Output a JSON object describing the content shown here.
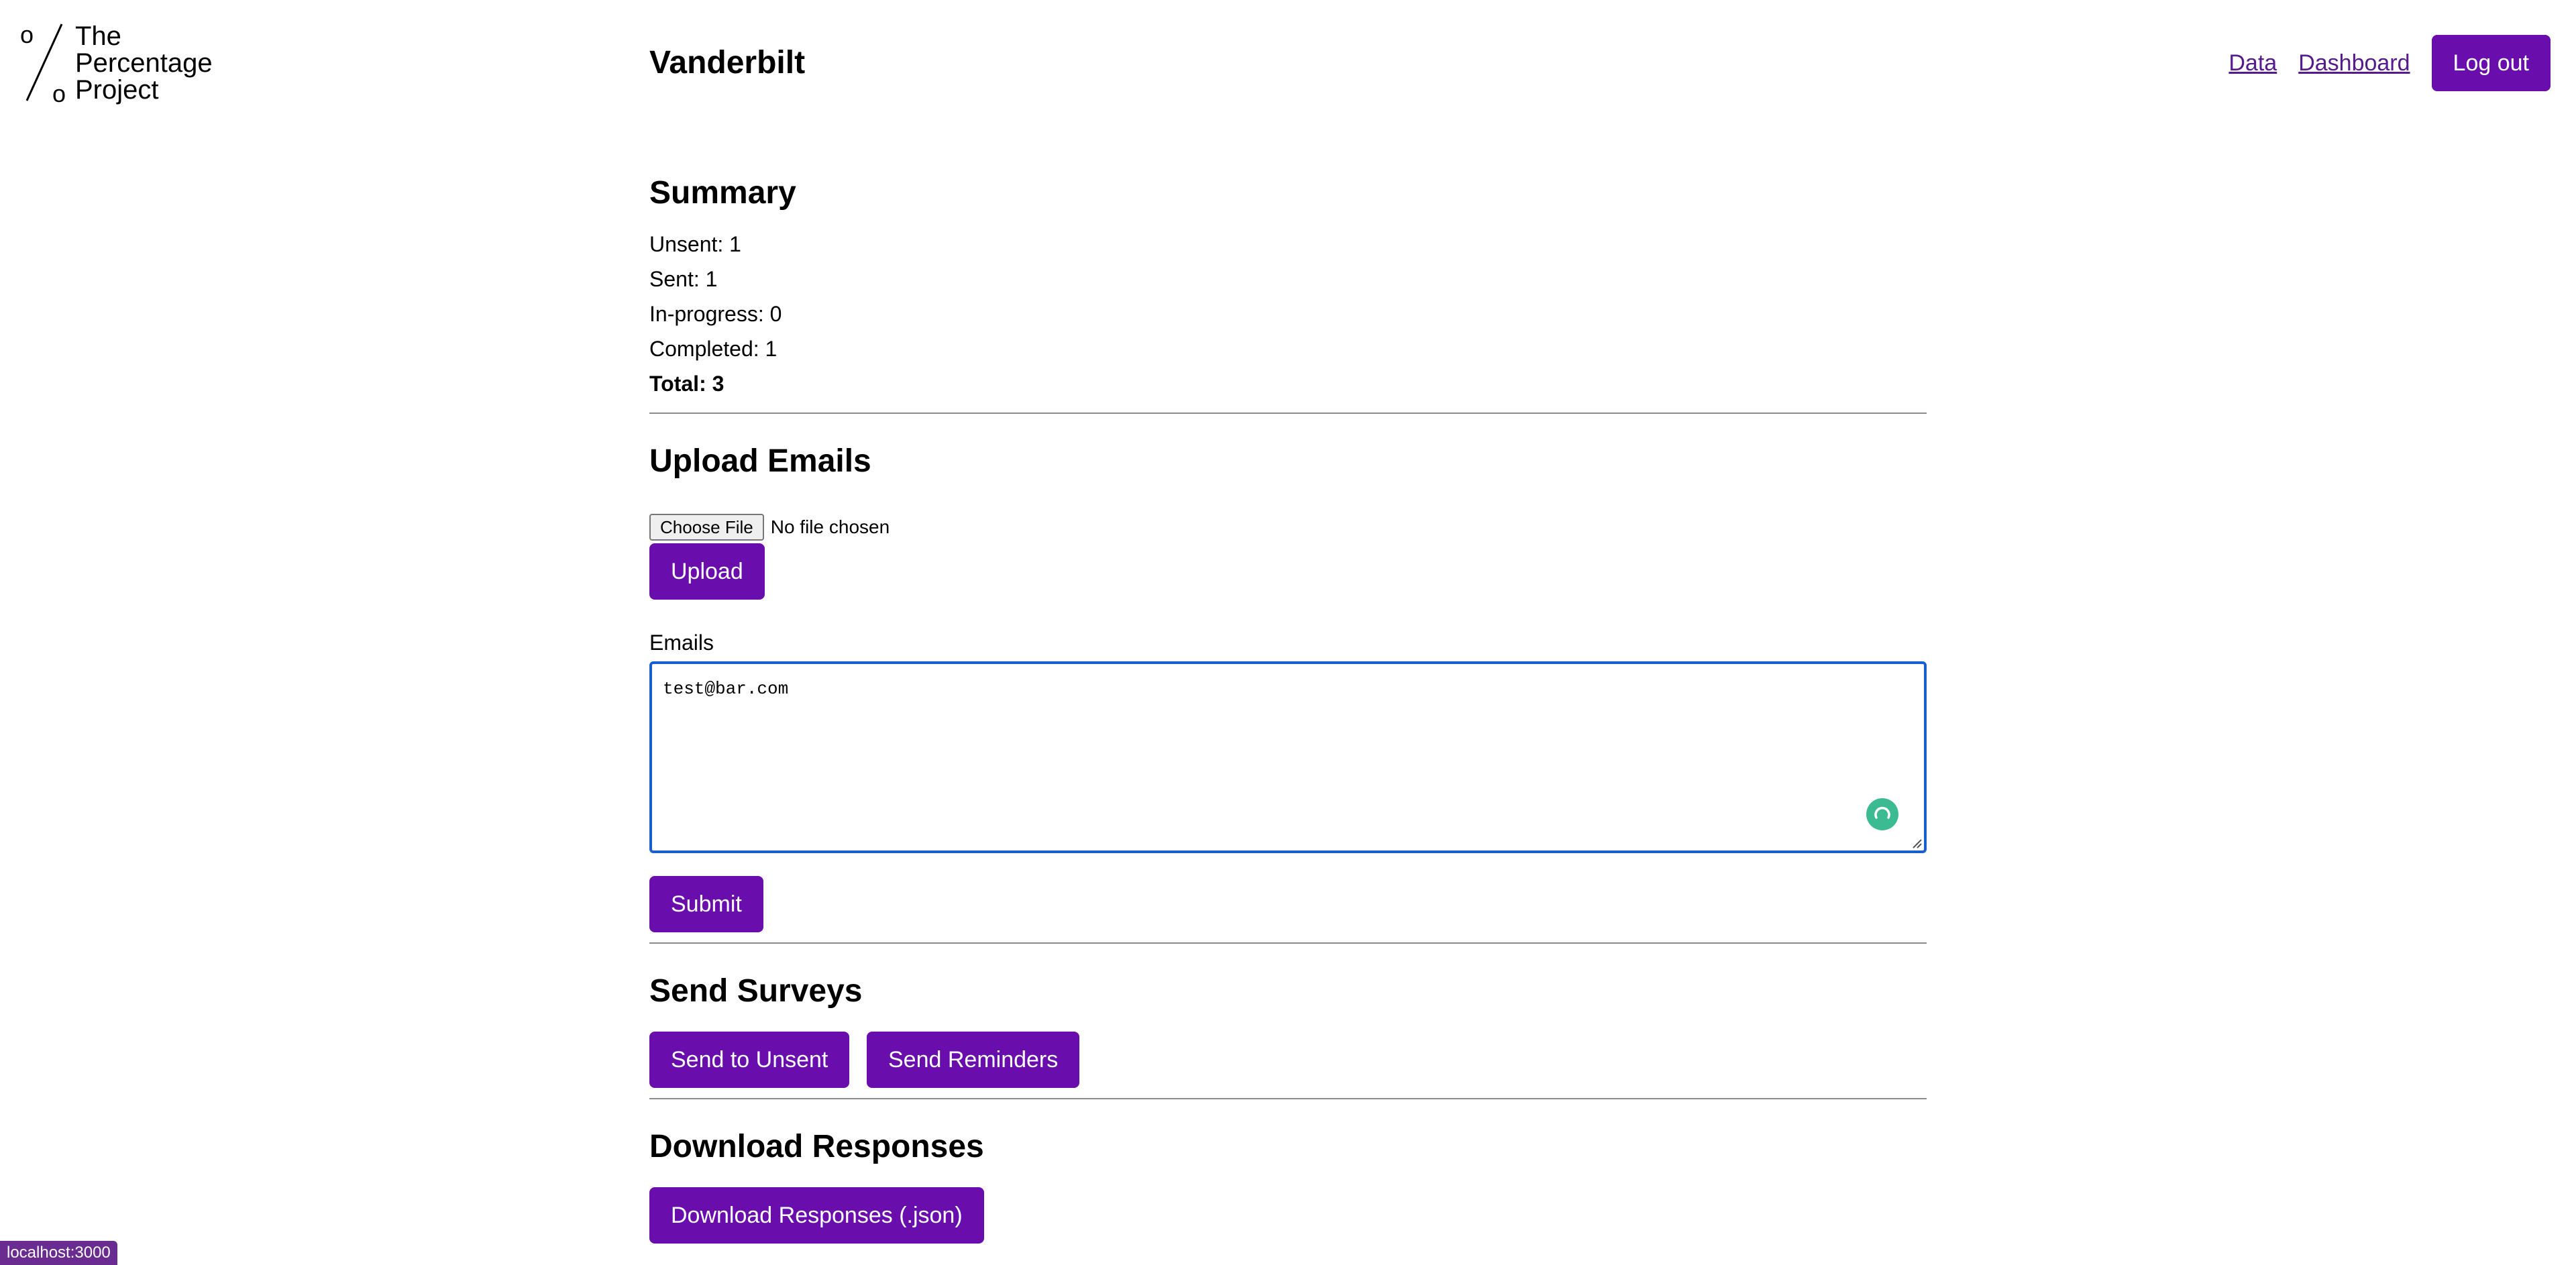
{
  "logo": {
    "glyph_top": "o",
    "glyph_bottom": "o",
    "lines": [
      "The",
      "Percentage",
      "Project"
    ]
  },
  "header": {
    "org_name": "Vanderbilt",
    "nav": {
      "data_link": "Data",
      "dashboard_link": "Dashboard",
      "logout_label": "Log out"
    }
  },
  "summary": {
    "title": "Summary",
    "unsent": "Unsent: 1",
    "sent": "Sent: 1",
    "in_progress": "In-progress: 0",
    "completed": "Completed: 1",
    "total": "Total: 3"
  },
  "upload": {
    "title": "Upload Emails",
    "choose_file_label": "Choose File",
    "no_file_text": "No file chosen",
    "upload_label": "Upload",
    "emails_label": "Emails",
    "emails_value": "test@bar.com",
    "submit_label": "Submit"
  },
  "send": {
    "title": "Send Surveys",
    "send_unsent_label": "Send to Unsent",
    "send_reminders_label": "Send Reminders"
  },
  "download": {
    "title": "Download Responses",
    "download_label": "Download Responses (.json)"
  },
  "status_bar": {
    "url": "localhost:3000"
  },
  "colors": {
    "accent": "#6a0dad",
    "link": "#551a8b",
    "focus": "#1a5fd0",
    "grammarly": "#3cba92"
  }
}
